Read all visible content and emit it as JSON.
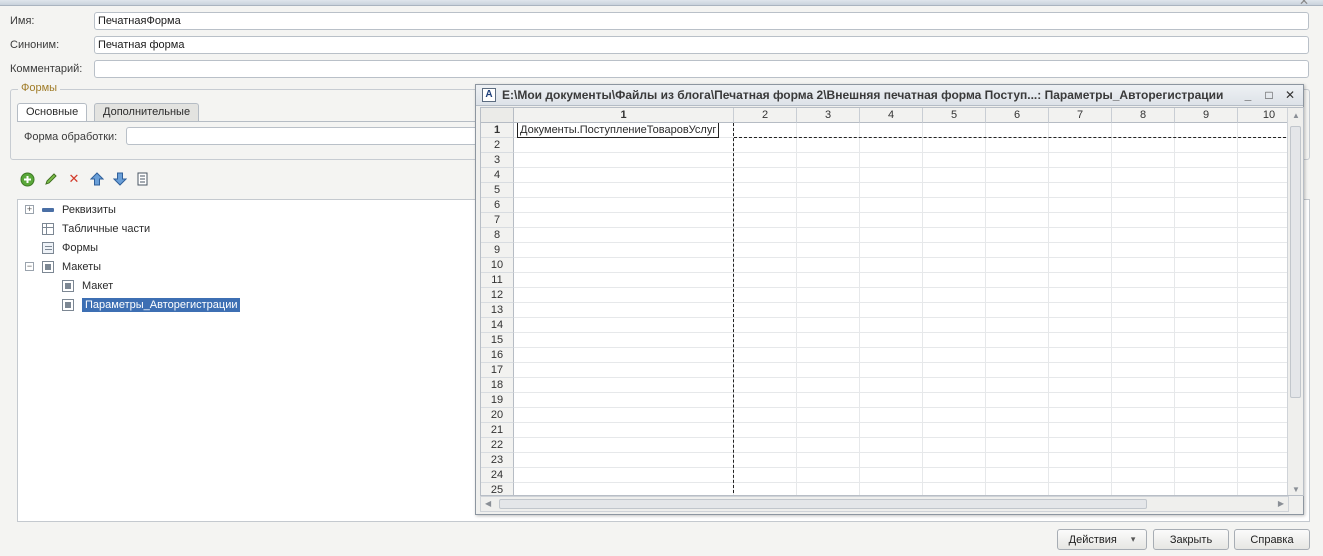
{
  "form": {
    "name_label": "Имя:",
    "name_value": "ПечатнаяФорма",
    "synonym_label": "Синоним:",
    "synonym_value": "Печатная форма",
    "comment_label": "Комментарий:",
    "comment_value": ""
  },
  "forms_group": {
    "caption": "Формы",
    "tabs": [
      {
        "label": "Основные",
        "active": true
      },
      {
        "label": "Дополнительные",
        "active": false
      }
    ],
    "processing_form_label": "Форма обработки:",
    "processing_form_value": ""
  },
  "toolbar": {
    "icons": [
      "add-icon",
      "edit-icon",
      "delete-icon",
      "move-up-icon",
      "move-down-icon",
      "list-icon"
    ]
  },
  "tree": {
    "items": [
      {
        "label": "Реквизиты",
        "icon": "attribute-icon",
        "expander": "+"
      },
      {
        "label": "Табличные части",
        "icon": "table-icon"
      },
      {
        "label": "Формы",
        "icon": "form-icon"
      },
      {
        "label": "Макеты",
        "icon": "template-icon",
        "expander": "−"
      },
      {
        "label": "Макет",
        "icon": "template-icon"
      },
      {
        "label": "Параметры_Авторегистрации",
        "icon": "template-icon",
        "selected": true
      }
    ]
  },
  "sheet_window": {
    "title": "E:\\Мои документы\\Файлы из блога\\Печатная форма 2\\Внешняя печатная форма Поступ...: Параметры_Авторегистрации",
    "columns": [
      "1",
      "2",
      "3",
      "4",
      "5",
      "6",
      "7",
      "8",
      "9",
      "10"
    ],
    "rows": [
      "1",
      "2",
      "3",
      "4",
      "5",
      "6",
      "7",
      "8",
      "9",
      "10",
      "11",
      "12",
      "13",
      "14",
      "15",
      "16",
      "17",
      "18",
      "19",
      "20",
      "21",
      "22",
      "23",
      "24",
      "25"
    ],
    "cell_r1c1": "Документы.ПоступлениеТоваровУслуг",
    "controls": {
      "minimize": "_",
      "maximize": "□",
      "close": "✕"
    }
  },
  "buttons": {
    "actions": "Действия",
    "actions_arrow": "▾",
    "close": "Закрыть",
    "help": "Справка"
  },
  "colors": {
    "selection": "#3d6fb3",
    "group_caption": "#a07c28"
  }
}
